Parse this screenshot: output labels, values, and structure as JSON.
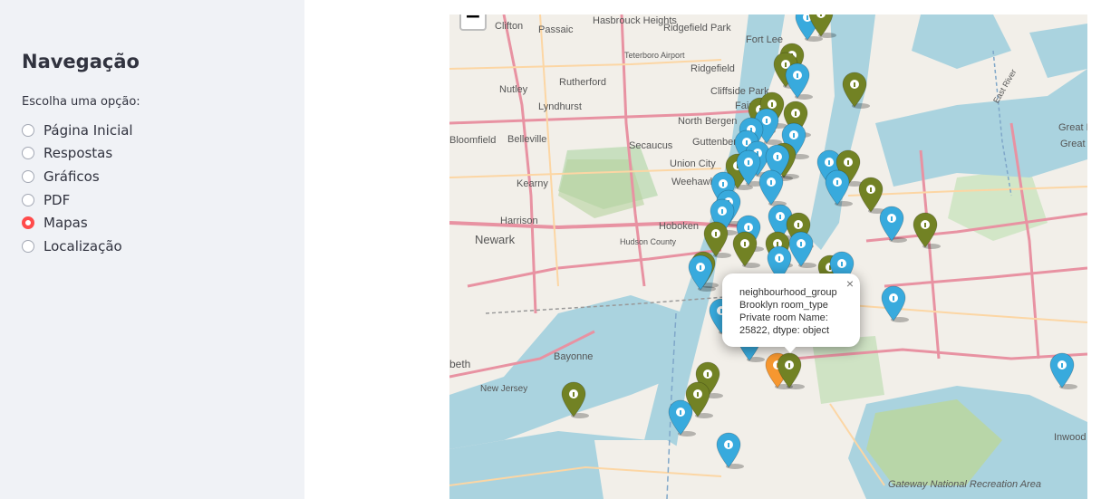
{
  "sidebar": {
    "title": "Navegação",
    "radio_label": "Escolha uma opção:",
    "options": [
      "Página Inicial",
      "Respostas",
      "Gráficos",
      "PDF",
      "Mapas",
      "Localização"
    ],
    "selected": "Mapas"
  },
  "map": {
    "zoom_out_label": "−",
    "popup": {
      "text": "neighbourhood_group Brooklyn room_type Private room Name: 25822, dtype: object",
      "close_label": "×"
    },
    "labels": [
      "Clifton",
      "Passaic",
      "Hasbrouck Heights",
      "Ridgefield Park",
      "Fort Lee",
      "Teterboro Airport",
      "Ridgefield",
      "Nutley",
      "Rutherford",
      "Cliffside Park",
      "Lyndhurst",
      "Fairview",
      "North Bergen",
      "Bloomfield",
      "Belleville",
      "Secaucus",
      "Guttenberg",
      "Union City",
      "Kearny",
      "Weehawken",
      "Harrison",
      "Hoboken",
      "Newark",
      "Hudson County",
      "Bayonne",
      "New Jersey",
      "Great Neck",
      "Great Plains",
      "Inwood",
      "Gateway National Recreation Area",
      "East River",
      "beth"
    ],
    "marker_colors": {
      "blue": "#38aadd",
      "olive": "#728224",
      "orange": "#f69730"
    }
  }
}
